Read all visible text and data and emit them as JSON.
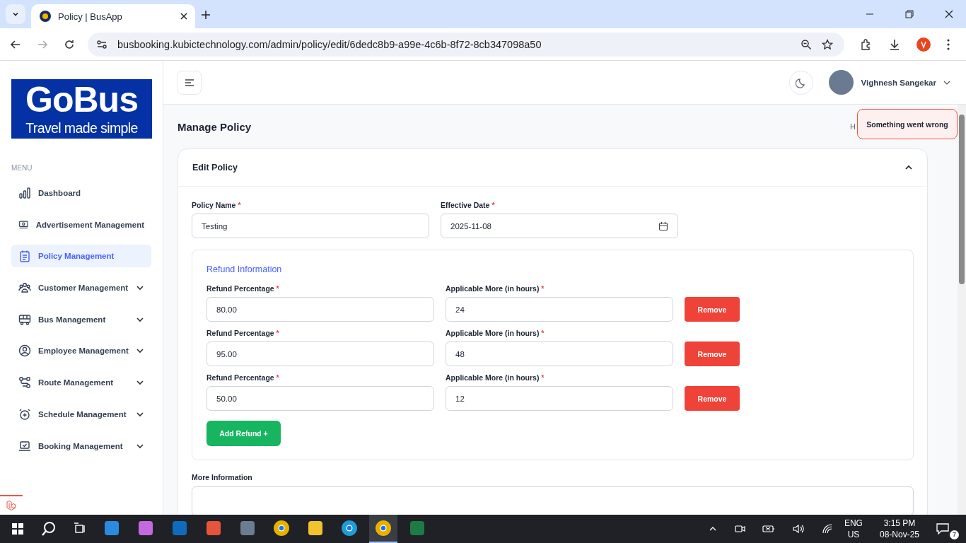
{
  "browser": {
    "tab_title": "Policy | BusApp",
    "url": "busbooking.kubictechnology.com/admin/policy/edit/6dedc8b9-a99e-4c6b-8f72-8cb347098a50"
  },
  "sidebar": {
    "logo_title": "GoBus",
    "logo_tagline": "Travel made simple",
    "menu_heading": "MENU",
    "items": [
      {
        "label": "Dashboard",
        "kind": "chart",
        "selected": false,
        "expandable": false
      },
      {
        "label": "Advertisement Management",
        "kind": "money",
        "selected": false,
        "expandable": false
      },
      {
        "label": "Policy Management",
        "kind": "clipboard",
        "selected": true,
        "expandable": false
      },
      {
        "label": "Customer Management",
        "kind": "people",
        "selected": false,
        "expandable": true
      },
      {
        "label": "Bus Management",
        "kind": "bus",
        "selected": false,
        "expandable": true
      },
      {
        "label": "Employee Management",
        "kind": "user",
        "selected": false,
        "expandable": true
      },
      {
        "label": "Route Management",
        "kind": "route",
        "selected": false,
        "expandable": true
      },
      {
        "label": "Schedule Management",
        "kind": "alarm",
        "selected": false,
        "expandable": true
      },
      {
        "label": "Booking Management",
        "kind": "laptop",
        "selected": false,
        "expandable": true
      }
    ]
  },
  "header": {
    "user_name": "Vighnesh Sangekar"
  },
  "page": {
    "title": "Manage Policy",
    "breadcrumb": "H"
  },
  "toast": {
    "message": "Something went wrong"
  },
  "card": {
    "title": "Edit Policy",
    "expanded": true,
    "policy_name": {
      "label": "Policy Name",
      "required_mark": "*",
      "value": "Testing"
    },
    "effective_date": {
      "label": "Effective Date",
      "required_mark": "*",
      "value": "2025-11-08"
    },
    "refund": {
      "title": "Refund Information",
      "rows": [
        {
          "percentage_label": "Refund Percentage",
          "percentage_required_mark": "*",
          "percentage": "80.00",
          "hours_label": "Applicable More (in hours)",
          "hours_required_mark": "*",
          "hours": "24",
          "remove": "Remove"
        },
        {
          "percentage_label": "Refund Percentage",
          "percentage_required_mark": "*",
          "percentage": "95.00",
          "hours_label": "Applicable More (in hours)",
          "hours_required_mark": "*",
          "hours": "48",
          "remove": "Remove"
        },
        {
          "percentage_label": "Refund Percentage",
          "percentage_required_mark": "*",
          "percentage": "50.00",
          "hours_label": "Applicable More (in hours)",
          "hours_required_mark": "*",
          "hours": "12",
          "remove": "Remove"
        }
      ],
      "add_button": "Add Refund +"
    },
    "more_title": "More Information"
  },
  "taskbar": {
    "apps": [
      {
        "kind": "vscode",
        "selected": false
      },
      {
        "kind": "copilot",
        "selected": false
      },
      {
        "kind": "outlook",
        "selected": false
      },
      {
        "kind": "store",
        "selected": false
      },
      {
        "kind": "calculator",
        "selected": false
      },
      {
        "kind": "chrome",
        "selected": false
      },
      {
        "kind": "files",
        "selected": false
      },
      {
        "kind": "edge",
        "selected": false
      },
      {
        "kind": "chrome",
        "selected": true
      },
      {
        "kind": "excel",
        "selected": false
      }
    ],
    "language": "ENG",
    "region": "US",
    "time": "3:15 PM",
    "date": "08-Nov-25",
    "notifications": "7"
  }
}
